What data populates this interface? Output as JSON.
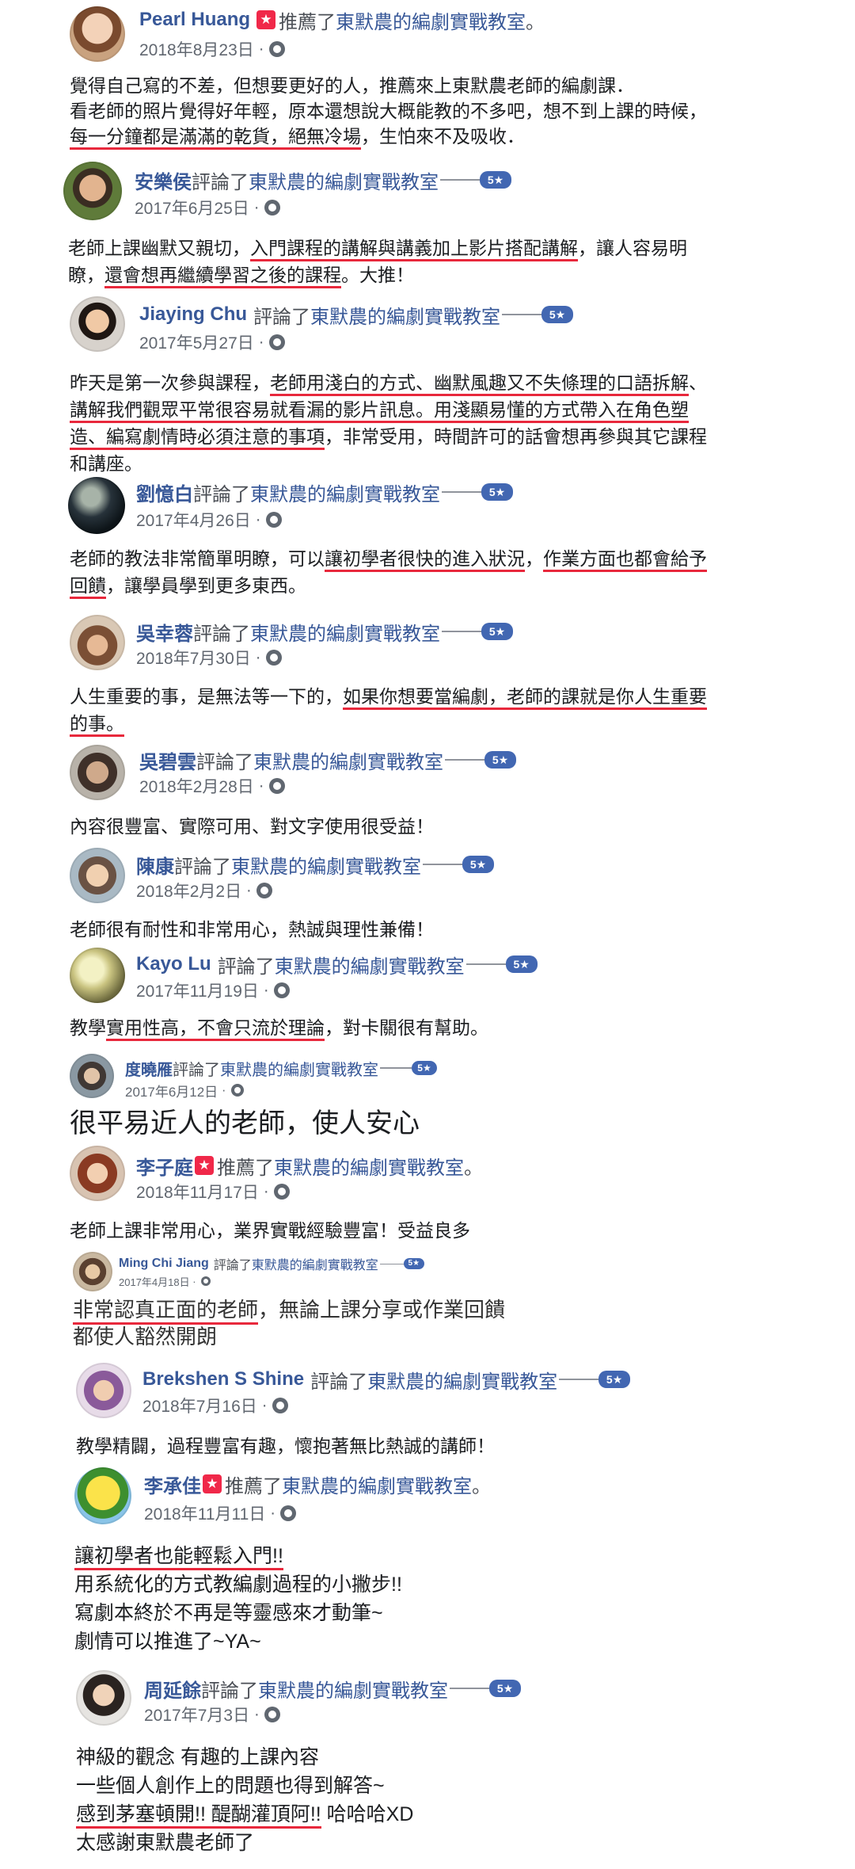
{
  "colors": {
    "name": "#385898",
    "meta": "#616770",
    "underline": "#e8283c",
    "star_badge": "#4267b2",
    "recommend_badge": "#f02849"
  },
  "page_name": "東默農的編劇實戰教室",
  "action_review": "評論了",
  "action_recommend": "推薦了",
  "star_label": "5★",
  "recommend_icon": "★",
  "reviews": [
    {
      "name": "Pearl Huang",
      "date": "2018年8月23日",
      "lines": [
        {
          "plain": "覺得自己寫的不差，但想要更好的人，推薦來上東默農老師的編劇課．"
        },
        {
          "plain": "看老師的照片覺得好年輕，原本還想說大概能教的不多吧，想不到上課的時候，"
        },
        {
          "ul": "每一分鐘都是滿滿的乾貨，絕無冷場",
          "rest": "，生怕來不及吸收．"
        }
      ]
    },
    {
      "name": "安樂侯",
      "date": "2017年6月25日",
      "lines": [
        {
          "plain": "老師上課幽默又親切，",
          "ul": "入門課程的講解與講義加上影片搭配講解",
          "rest": "，讓人容易明"
        },
        {
          "plain": "瞭，",
          "ul": "還會想再繼續學習之後的課程",
          "rest": "。大推！"
        }
      ]
    },
    {
      "name": "Jiaying Chu",
      "date": "2017年5月27日",
      "lines": [
        {
          "plain": "昨天是第一次參與課程，",
          "ul": "老師用淺白的方式、幽默風趣又不失條理的口語拆解",
          "rest": "、"
        },
        {
          "ul": "講解我們觀眾平常很容易就看漏的影片訊息。用淺顯易懂的方式帶入在角色塑"
        },
        {
          "ul": "造、編寫劇情時必須注意的事項",
          "rest": "，非常受用，時間許可的話會想再參與其它課程"
        },
        {
          "plain": "和講座。"
        }
      ]
    },
    {
      "name": "劉憶白",
      "date": "2017年4月26日",
      "lines": [
        {
          "plain": "老師的教法非常簡單明瞭，可以",
          "ul": "讓初學者很快的進入狀況",
          "rest": "，"
        },
        {
          "ul": "回饋",
          "rest": "，讓學員學到更多東西。"
        }
      ],
      "line1_tail": "作業方面也都會給予"
    },
    {
      "name": "吳幸蓉",
      "date": "2018年7月30日",
      "lines": [
        {
          "plain": "人生重要的事，是無法等一下的，",
          "ul": "如果你想要當編劇，老師的課就是你人生重要"
        },
        {
          "ul": "的事。"
        }
      ]
    },
    {
      "name": "吳碧雲",
      "date": "2018年2月28日",
      "lines": [
        {
          "plain": "內容很豐富、實際可用、對文字使用很受益！"
        }
      ]
    },
    {
      "name": "陳康",
      "date": "2018年2月2日",
      "lines": [
        {
          "plain": "老師很有耐性和非常用心，熱誠與理性兼備！"
        }
      ]
    },
    {
      "name": "Kayo Lu",
      "date": "2017年11月19日",
      "lines": [
        {
          "plain": "教學",
          "ul": "實用性高，不會只流於理論",
          "rest": "，對卡關很有幫助。"
        }
      ]
    },
    {
      "name": "度曉雁",
      "date": "2017年6月12日",
      "lines": [
        {
          "plain": "很平易近人的老師，使人安心"
        }
      ]
    },
    {
      "name": "李子庭",
      "date": "2018年11月17日",
      "lines": [
        {
          "plain": "老師上課非常用心，業界實戰經驗豐富！受益良多"
        }
      ]
    },
    {
      "name": "Ming Chi Jiang",
      "date": "2017年4月18日",
      "lines": [
        {
          "ul": "非常認真正面的老師",
          "rest": "，無論上課分享或作業回饋"
        },
        {
          "plain": "都使人豁然開朗"
        }
      ]
    },
    {
      "name": "Brekshen S Shine",
      "date": "2018年7月16日",
      "lines": [
        {
          "plain": "教學精闢，過程豐富有趣，懷抱著無比熱誠的講師！"
        }
      ]
    },
    {
      "name": "李承佳",
      "date": "2018年11月11日",
      "lines": [
        {
          "ul": "讓初學者也能輕鬆入門!!"
        },
        {
          "plain": "用系統化的方式教編劇過程的小撇步!!"
        },
        {
          "plain": "寫劇本終於不再是等靈感來才動筆~"
        },
        {
          "plain": "劇情可以推進了~YA~"
        }
      ]
    },
    {
      "name": "周延餘",
      "date": "2017年7月3日",
      "lines": [
        {
          "plain": "神級的觀念 有趣的上課內容"
        },
        {
          "plain": "一些個人創作上的問題也得到解答~"
        },
        {
          "ul": "感到茅塞頓開!! 醍醐灌頂阿!!",
          "rest": " 哈哈哈XD"
        },
        {
          "plain": "太感謝東默農老師了"
        }
      ]
    }
  ]
}
